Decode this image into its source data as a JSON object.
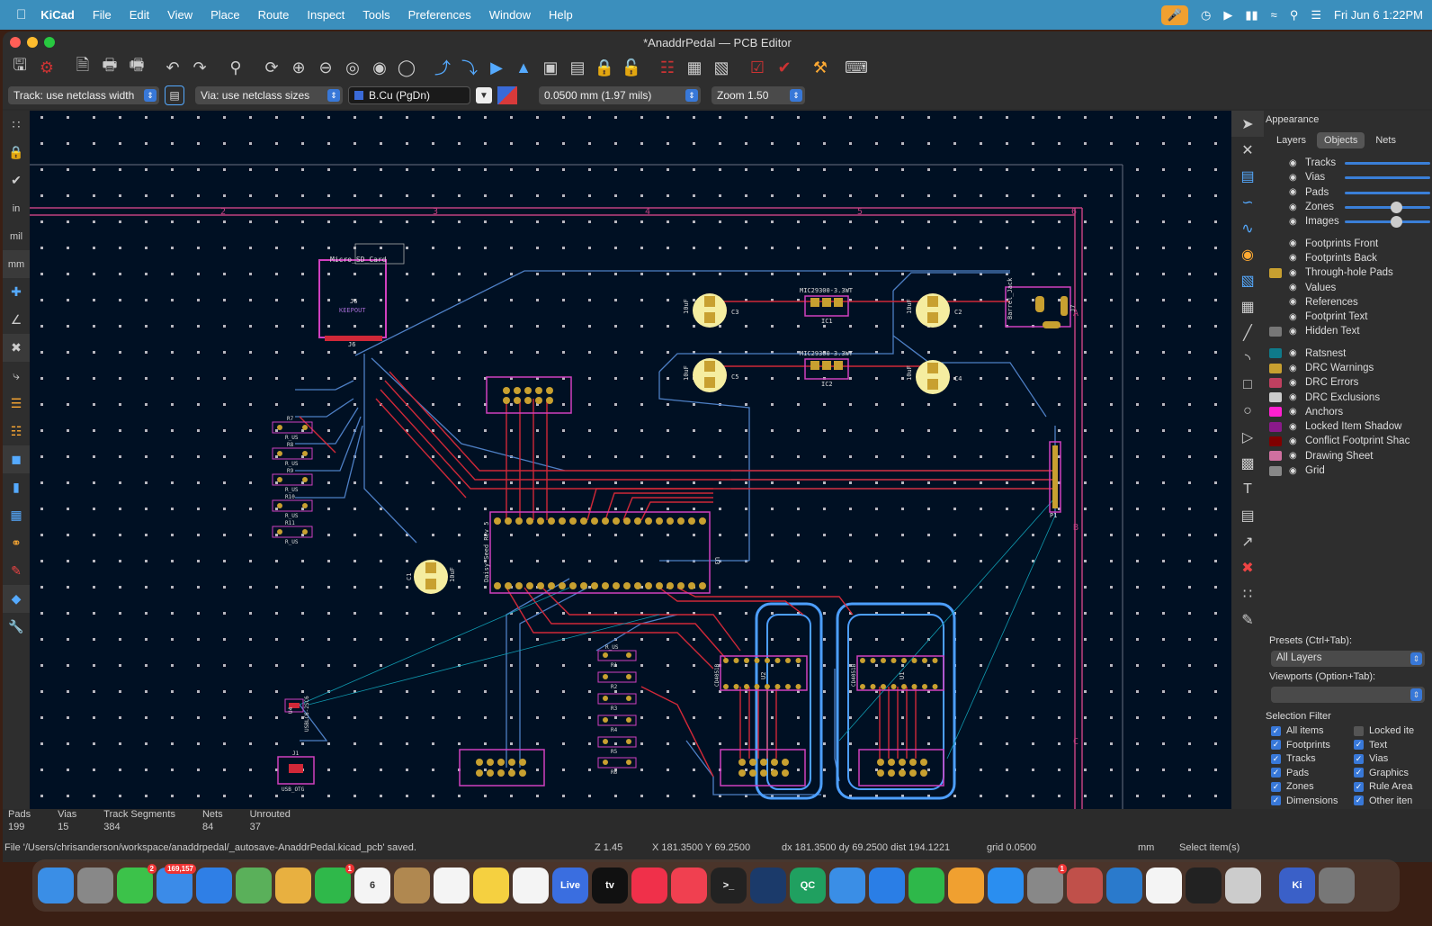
{
  "menubar": {
    "app": "KiCad",
    "items": [
      "File",
      "Edit",
      "View",
      "Place",
      "Route",
      "Inspect",
      "Tools",
      "Preferences",
      "Window",
      "Help"
    ],
    "clock": "Fri Jun 6  1:22PM"
  },
  "window": {
    "title": "*AnaddrPedal — PCB Editor"
  },
  "options": {
    "track": "Track: use netclass width",
    "via": "Via: use netclass sizes",
    "layer": "B.Cu (PgDn)",
    "grid": "0.0500 mm (1.97 mils)",
    "zoom": "Zoom 1.50"
  },
  "lefttools": {
    "in": "in",
    "mil": "mil",
    "mm": "mm"
  },
  "panel": {
    "title": "Appearance",
    "tabs": [
      "Layers",
      "Objects",
      "Nets"
    ],
    "objects": [
      {
        "label": "Tracks",
        "color": "",
        "slider": 1.0
      },
      {
        "label": "Vias",
        "color": "",
        "slider": 1.0
      },
      {
        "label": "Pads",
        "color": "",
        "slider": 1.0
      },
      {
        "label": "Zones",
        "color": "",
        "slider": 0.6
      },
      {
        "label": "Images",
        "color": "",
        "slider": 0.6
      },
      {
        "label": "Footprints Front",
        "color": ""
      },
      {
        "label": "Footprints Back",
        "color": ""
      },
      {
        "label": "Through-hole Pads",
        "color": "#c8a030"
      },
      {
        "label": "Values",
        "color": ""
      },
      {
        "label": "References",
        "color": ""
      },
      {
        "label": "Footprint Text",
        "color": ""
      },
      {
        "label": "Hidden Text",
        "color": "#777777"
      },
      {
        "label": "Ratsnest",
        "color": "#0f7a8a"
      },
      {
        "label": "DRC Warnings",
        "color": "#c8a030"
      },
      {
        "label": "DRC Errors",
        "color": "#c04060"
      },
      {
        "label": "DRC Exclusions",
        "color": "#cccccc"
      },
      {
        "label": "Anchors",
        "color": "#ff20d0"
      },
      {
        "label": "Locked Item Shadow",
        "color": "#8a1a8a"
      },
      {
        "label": "Conflict Footprint Shac",
        "color": "#800000"
      },
      {
        "label": "Drawing Sheet",
        "color": "#d070a0"
      },
      {
        "label": "Grid",
        "color": "#888888"
      }
    ],
    "presets_label": "Presets (Ctrl+Tab):",
    "presets_value": "All Layers",
    "viewports_label": "Viewports (Option+Tab):",
    "filter_title": "Selection Filter",
    "filter": [
      {
        "label": "All items",
        "on": true
      },
      {
        "label": "Locked ite",
        "on": false
      },
      {
        "label": "Footprints",
        "on": true
      },
      {
        "label": "Text",
        "on": true
      },
      {
        "label": "Tracks",
        "on": true
      },
      {
        "label": "Vias",
        "on": true
      },
      {
        "label": "Pads",
        "on": true
      },
      {
        "label": "Graphics",
        "on": true
      },
      {
        "label": "Zones",
        "on": true
      },
      {
        "label": "Rule Area",
        "on": true
      },
      {
        "label": "Dimensions",
        "on": true
      },
      {
        "label": "Other iten",
        "on": true
      }
    ]
  },
  "stats": [
    {
      "k": "Pads",
      "v": "199"
    },
    {
      "k": "Vias",
      "v": "15"
    },
    {
      "k": "Track Segments",
      "v": "384"
    },
    {
      "k": "Nets",
      "v": "84"
    },
    {
      "k": "Unrouted",
      "v": "37"
    }
  ],
  "status": {
    "file": "File '/Users/chrisanderson/workspace/anaddrpedal/_autosave-AnaddrPedal.kicad_pcb' saved.",
    "zoom": "Z 1.45",
    "xy": "X 181.3500  Y 69.2500",
    "delta": "dx 181.3500  dy 69.2500  dist 194.1221",
    "grid": "grid 0.0500",
    "units": "mm",
    "mode": "Select item(s)"
  },
  "pcb": {
    "labels": {
      "sd": "Micro_SD_Card",
      "j6": "J6",
      "keepout": "KEEPOUT",
      "ic1": "MIC29300-3.3WT",
      "ic1ref": "IC1",
      "ic2": "MIC29300-3.3WT",
      "ic2ref": "IC2",
      "barrel": "Barrel_Jack",
      "j7": "J7",
      "c3": "C3",
      "c5": "C5",
      "c2": "C2",
      "c4": "C4",
      "c1": "C1",
      "cval": "10uF",
      "daisy": "Daisy_Seed Rev 5",
      "u3": "U3",
      "p1": "P1",
      "u1": "U1",
      "u2": "U2",
      "cd": "CD4051B",
      "usb": "USB_OTG",
      "usbic": "USBLC6-2SC6",
      "u4": "U4",
      "j1": "J1",
      "r7": "R7",
      "r8": "R8",
      "r9": "R9",
      "r10": "R10",
      "r11": "R11",
      "r1": "R1",
      "r2": "R2",
      "r3": "R3",
      "r4": "R4",
      "r5": "R5",
      "r6": "R6",
      "rus": "R_US",
      "n1": "1",
      "n2": "2",
      "n3": "3",
      "n4": "4",
      "n5": "5",
      "n6": "6",
      "la": "A",
      "lb": "B",
      "lc": "C"
    }
  },
  "dock": {
    "apps": [
      {
        "name": "finder",
        "color": "#3a8ee6",
        "text": ""
      },
      {
        "name": "launchpad",
        "color": "#888",
        "text": ""
      },
      {
        "name": "messages",
        "color": "#3cc24a",
        "text": "",
        "badge": "2"
      },
      {
        "name": "mail",
        "color": "#3b8be8",
        "text": "",
        "badge": "169,157"
      },
      {
        "name": "safari",
        "color": "#2f7fe6",
        "text": ""
      },
      {
        "name": "maps",
        "color": "#5ab05a",
        "text": ""
      },
      {
        "name": "photos",
        "color": "#e8b040",
        "text": ""
      },
      {
        "name": "facetime",
        "color": "#2fb84a",
        "text": "",
        "badge": "1"
      },
      {
        "name": "calendar",
        "color": "#f4f4f4",
        "text": "6"
      },
      {
        "name": "contacts",
        "color": "#b08850",
        "text": ""
      },
      {
        "name": "reminders",
        "color": "#f4f4f4",
        "text": ""
      },
      {
        "name": "notes",
        "color": "#f5d040",
        "text": ""
      },
      {
        "name": "freeform",
        "color": "#f4f4f4",
        "text": ""
      },
      {
        "name": "live",
        "color": "#3a6ee0",
        "text": "Live"
      },
      {
        "name": "tv",
        "color": "#111",
        "text": "tv"
      },
      {
        "name": "music",
        "color": "#f0304a",
        "text": ""
      },
      {
        "name": "news",
        "color": "#f04050",
        "text": ""
      },
      {
        "name": "terminal",
        "color": "#222",
        "text": ">_"
      },
      {
        "name": "steam",
        "color": "#1b3a6a",
        "text": ""
      },
      {
        "name": "qc",
        "color": "#20a060",
        "text": "QC"
      },
      {
        "name": "xcode",
        "color": "#3a8ee6",
        "text": ""
      },
      {
        "name": "keynote",
        "color": "#2a7ee6",
        "text": ""
      },
      {
        "name": "numbers",
        "color": "#2eb84a",
        "text": ""
      },
      {
        "name": "pages",
        "color": "#f0a030",
        "text": ""
      },
      {
        "name": "appstore",
        "color": "#2a8ef0",
        "text": ""
      },
      {
        "name": "settings",
        "color": "#888",
        "text": "",
        "badge": "1"
      },
      {
        "name": "instruments",
        "color": "#c0504a",
        "text": ""
      },
      {
        "name": "vscode",
        "color": "#2a7acc",
        "text": ""
      },
      {
        "name": "apple-config",
        "color": "#f4f4f4",
        "text": ""
      },
      {
        "name": "piano",
        "color": "#222",
        "text": ""
      },
      {
        "name": "disk-util",
        "color": "#ccc",
        "text": ""
      },
      {
        "name": "kicad",
        "color": "#3a60c8",
        "text": "Ki"
      },
      {
        "name": "trash",
        "color": "#777",
        "text": ""
      }
    ]
  }
}
